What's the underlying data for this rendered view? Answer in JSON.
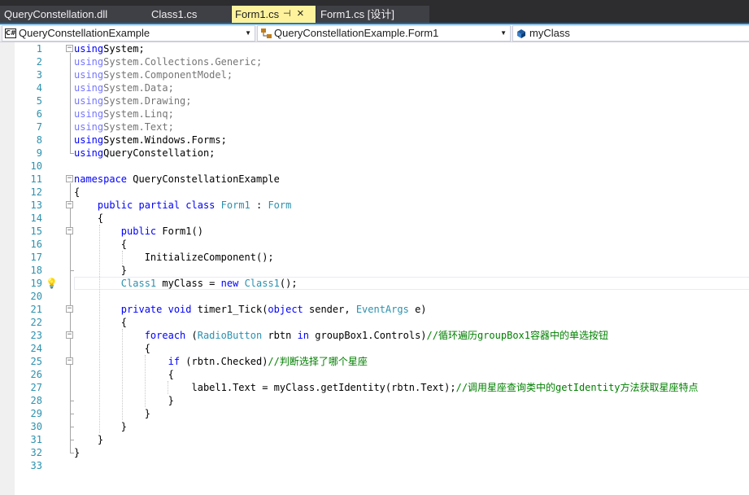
{
  "tabs": [
    {
      "label": "QueryConstellation.dll",
      "active": false
    },
    {
      "label": "Class1.cs",
      "active": false
    },
    {
      "label": "Form1.cs",
      "active": true,
      "pin_icon": "pin-icon",
      "close_icon": "close-icon"
    },
    {
      "label": "Form1.cs [设计]",
      "active": false
    }
  ],
  "navbar": {
    "project": {
      "icon": "csharp-project-icon",
      "icon_text": "C#",
      "value": "QueryConstellationExample"
    },
    "type": {
      "icon": "class-icon",
      "value": "QueryConstellationExample.Form1"
    },
    "member": {
      "icon": "field-icon",
      "value": "myClass"
    }
  },
  "editor": {
    "current_line": 19,
    "lightbulb_line": 19,
    "lines": [
      {
        "n": "1",
        "tokens": [
          [
            "kw",
            "using"
          ],
          [
            "",
            "System;"
          ]
        ]
      },
      {
        "n": "2",
        "dim": true,
        "tokens": [
          [
            "kw",
            "using"
          ],
          [
            "",
            "System.Collections.Generic;"
          ]
        ]
      },
      {
        "n": "3",
        "dim": true,
        "tokens": [
          [
            "kw",
            "using"
          ],
          [
            "",
            "System.ComponentModel;"
          ]
        ]
      },
      {
        "n": "4",
        "dim": true,
        "tokens": [
          [
            "kw",
            "using"
          ],
          [
            "",
            "System.Data;"
          ]
        ]
      },
      {
        "n": "5",
        "dim": true,
        "tokens": [
          [
            "kw",
            "using"
          ],
          [
            "",
            "System.Drawing;"
          ]
        ]
      },
      {
        "n": "6",
        "dim": true,
        "tokens": [
          [
            "kw",
            "using"
          ],
          [
            "",
            "System.Linq;"
          ]
        ]
      },
      {
        "n": "7",
        "dim": true,
        "tokens": [
          [
            "kw",
            "using"
          ],
          [
            "",
            "System.Text;"
          ]
        ]
      },
      {
        "n": "8",
        "tokens": [
          [
            "kw",
            "using"
          ],
          [
            "",
            "System.Windows.Forms;"
          ]
        ]
      },
      {
        "n": "9",
        "tokens": [
          [
            "kw",
            "using"
          ],
          [
            "",
            "QueryConstellation;"
          ]
        ]
      },
      {
        "n": "10",
        "tokens": []
      },
      {
        "n": "11",
        "tokens": [
          [
            "kw",
            "namespace"
          ],
          [
            "",
            " QueryConstellationExample"
          ]
        ]
      },
      {
        "n": "12",
        "tokens": [
          [
            "",
            "{"
          ]
        ]
      },
      {
        "n": "13",
        "tokens": [
          [
            "",
            "    "
          ],
          [
            "kw",
            "public partial class"
          ],
          [
            "",
            " "
          ],
          [
            "type",
            "Form1"
          ],
          [
            "",
            " : "
          ],
          [
            "type",
            "Form"
          ]
        ]
      },
      {
        "n": "14",
        "tokens": [
          [
            "",
            "    {"
          ]
        ]
      },
      {
        "n": "15",
        "tokens": [
          [
            "",
            "        "
          ],
          [
            "kw",
            "public"
          ],
          [
            "",
            " Form1()"
          ]
        ]
      },
      {
        "n": "16",
        "tokens": [
          [
            "",
            "        {"
          ]
        ]
      },
      {
        "n": "17",
        "tokens": [
          [
            "",
            "            InitializeComponent();"
          ]
        ]
      },
      {
        "n": "18",
        "tokens": [
          [
            "",
            "        }"
          ]
        ]
      },
      {
        "n": "19",
        "tokens": [
          [
            "",
            "        "
          ],
          [
            "type",
            "Class1"
          ],
          [
            "",
            " myClass = "
          ],
          [
            "kw",
            "new"
          ],
          [
            "",
            " "
          ],
          [
            "type",
            "Class1"
          ],
          [
            "",
            "();"
          ]
        ]
      },
      {
        "n": "20",
        "tokens": []
      },
      {
        "n": "21",
        "tokens": [
          [
            "",
            "        "
          ],
          [
            "kw",
            "private void"
          ],
          [
            "",
            " timer1_Tick("
          ],
          [
            "kw",
            "object"
          ],
          [
            "",
            " sender, "
          ],
          [
            "type",
            "EventArgs"
          ],
          [
            "",
            " e)"
          ]
        ]
      },
      {
        "n": "22",
        "tokens": [
          [
            "",
            "        {"
          ]
        ]
      },
      {
        "n": "23",
        "tokens": [
          [
            "",
            "            "
          ],
          [
            "kw",
            "foreach"
          ],
          [
            "",
            " ("
          ],
          [
            "type",
            "RadioButton"
          ],
          [
            "",
            " rbtn "
          ],
          [
            "kw",
            "in"
          ],
          [
            "",
            " groupBox1.Controls)"
          ],
          [
            "cmt",
            "//循环遍历groupBox1容器中的单选按钮"
          ]
        ]
      },
      {
        "n": "24",
        "tokens": [
          [
            "",
            "            {"
          ]
        ]
      },
      {
        "n": "25",
        "tokens": [
          [
            "",
            "                "
          ],
          [
            "kw",
            "if"
          ],
          [
            "",
            " (rbtn.Checked)"
          ],
          [
            "cmt",
            "//判断选择了哪个星座"
          ]
        ]
      },
      {
        "n": "26",
        "tokens": [
          [
            "",
            "                {"
          ]
        ]
      },
      {
        "n": "27",
        "tokens": [
          [
            "",
            "                    label1.Text = myClass.getIdentity(rbtn.Text);"
          ],
          [
            "cmt",
            "//调用星座查询类中的getIdentity方法获取星座特点"
          ]
        ]
      },
      {
        "n": "28",
        "tokens": [
          [
            "",
            "                }"
          ]
        ]
      },
      {
        "n": "29",
        "tokens": [
          [
            "",
            "            }"
          ]
        ]
      },
      {
        "n": "30",
        "tokens": [
          [
            "",
            "        }"
          ]
        ]
      },
      {
        "n": "31",
        "tokens": [
          [
            "",
            "    }"
          ]
        ]
      },
      {
        "n": "32",
        "tokens": [
          [
            "",
            "}"
          ]
        ]
      },
      {
        "n": "33",
        "tokens": []
      }
    ],
    "fold_lines": [
      1,
      11,
      13,
      15,
      21,
      23,
      25
    ],
    "fold_glyph": "−"
  },
  "colors": {
    "keyword": "#0000ff",
    "type": "#2b91af",
    "comment": "#008000",
    "line_number": "#2b91af",
    "tab_active_bg": "#fff29d",
    "accent": "#007acc"
  }
}
